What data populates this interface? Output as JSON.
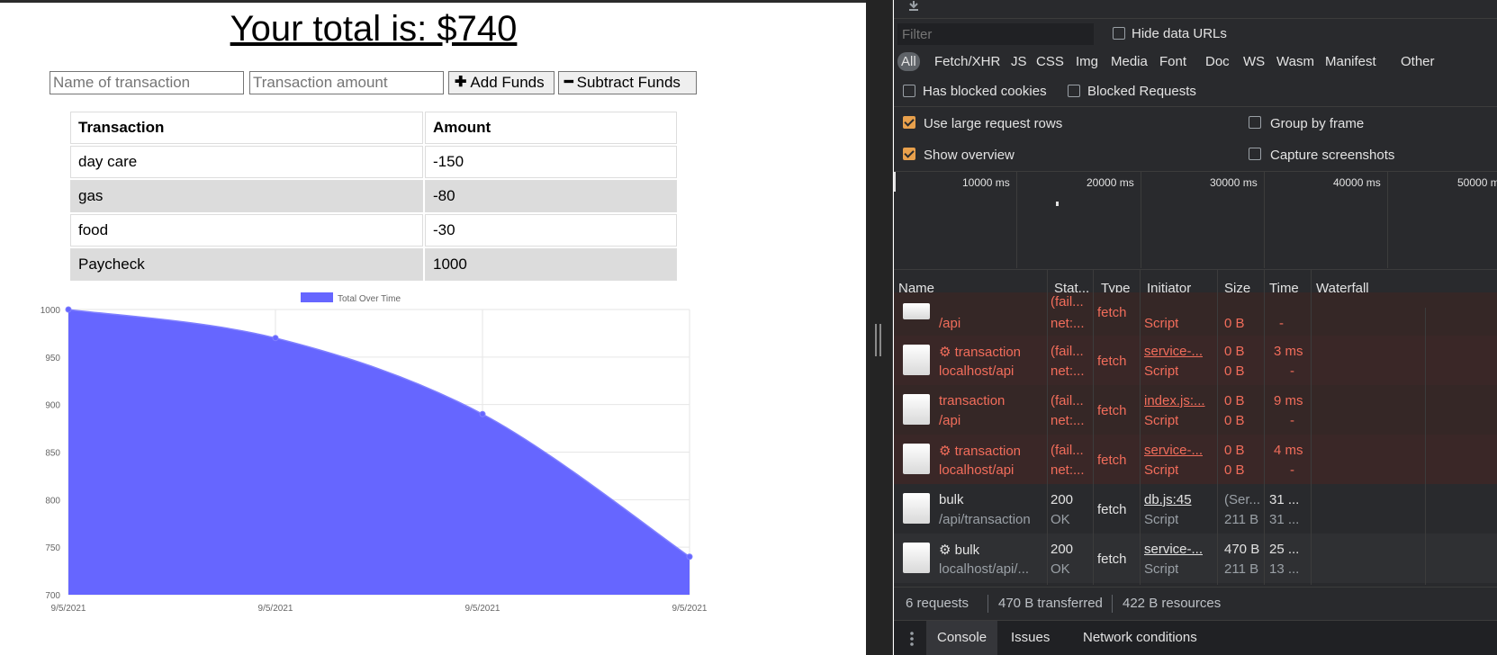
{
  "app": {
    "total_text": "Your total is: $740",
    "name_placeholder": "Name of transaction",
    "amount_placeholder": "Transaction amount",
    "add_button": "Add Funds",
    "subtract_button": "Subtract Funds",
    "table": {
      "headers": [
        "Transaction",
        "Amount"
      ],
      "rows": [
        {
          "name": "day care",
          "amount": "-150"
        },
        {
          "name": "gas",
          "amount": "-80"
        },
        {
          "name": "food",
          "amount": "-30"
        },
        {
          "name": "Paycheck",
          "amount": "1000"
        }
      ]
    }
  },
  "chart_data": {
    "type": "area",
    "categories": [
      "9/5/2021",
      "9/5/2021",
      "9/5/2021",
      "9/5/2021"
    ],
    "series": [
      {
        "name": "Total Over Time",
        "values": [
          1000,
          970,
          890,
          740
        ],
        "color": "#6666ff"
      }
    ],
    "ylim": [
      700,
      1000
    ],
    "yticks": [
      1000,
      950,
      900,
      850,
      800,
      750,
      700
    ],
    "grid": true,
    "legend": "top"
  },
  "devtools": {
    "filter_placeholder": "Filter",
    "hide_data_urls": "Hide data URLs",
    "types": [
      "All",
      "Fetch/XHR",
      "JS",
      "CSS",
      "Img",
      "Media",
      "Font",
      "Doc",
      "WS",
      "Wasm",
      "Manifest",
      "Other"
    ],
    "has_blocked_cookies": "Has blocked cookies",
    "blocked_requests": "Blocked Requests",
    "use_large_rows": "Use large request rows",
    "group_by_frame": "Group by frame",
    "show_overview": "Show overview",
    "capture_screenshots": "Capture screenshots",
    "timeline_ticks": [
      "10000 ms",
      "20000 ms",
      "30000 ms",
      "40000 ms",
      "50000 ms"
    ],
    "columns": [
      "Name",
      "Stat...",
      "Type",
      "Initiator",
      "Size",
      "Time",
      "Waterfall"
    ],
    "requests": [
      {
        "name": "",
        "path": "/api",
        "status": "(fail...",
        "status2": "net:...",
        "type": "fetch",
        "initiator": "",
        "initiator2": "Script",
        "size": "0 B",
        "size2": "0 B",
        "time": "",
        "time2": "-",
        "error": true,
        "gear": false
      },
      {
        "name": "transaction",
        "path": "localhost/api",
        "status": "(fail...",
        "status2": "net:...",
        "type": "fetch",
        "initiator": "service-...",
        "initiator2": "Script",
        "size": "0 B",
        "size2": "0 B",
        "time": "3 ms",
        "time2": "-",
        "error": true,
        "gear": true
      },
      {
        "name": "transaction",
        "path": "/api",
        "status": "(fail...",
        "status2": "net:...",
        "type": "fetch",
        "initiator": "index.js:...",
        "initiator2": "Script",
        "size": "0 B",
        "size2": "0 B",
        "time": "9 ms",
        "time2": "-",
        "error": true,
        "gear": false
      },
      {
        "name": "transaction",
        "path": "localhost/api",
        "status": "(fail...",
        "status2": "net:...",
        "type": "fetch",
        "initiator": "service-...",
        "initiator2": "Script",
        "size": "0 B",
        "size2": "0 B",
        "time": "4 ms",
        "time2": "-",
        "error": true,
        "gear": true
      },
      {
        "name": "bulk",
        "path": "/api/transaction",
        "status": "200",
        "status2": "OK",
        "type": "fetch",
        "initiator": "db.js:45",
        "initiator2": "Script",
        "size": "(Ser...",
        "size2": "211 B",
        "time": "31 ...",
        "time2": "31 ...",
        "error": false,
        "gear": false
      },
      {
        "name": "bulk",
        "path": "localhost/api/...",
        "status": "200",
        "status2": "OK",
        "type": "fetch",
        "initiator": "service-...",
        "initiator2": "Script",
        "size": "470 B",
        "size2": "211 B",
        "time": "25 ...",
        "time2": "13 ...",
        "error": false,
        "gear": true
      }
    ],
    "status": {
      "requests": "6 requests",
      "transferred": "470 B transferred",
      "resources": "422 B resources"
    },
    "drawer_tabs": [
      "Console",
      "Issues",
      "Network conditions"
    ]
  }
}
